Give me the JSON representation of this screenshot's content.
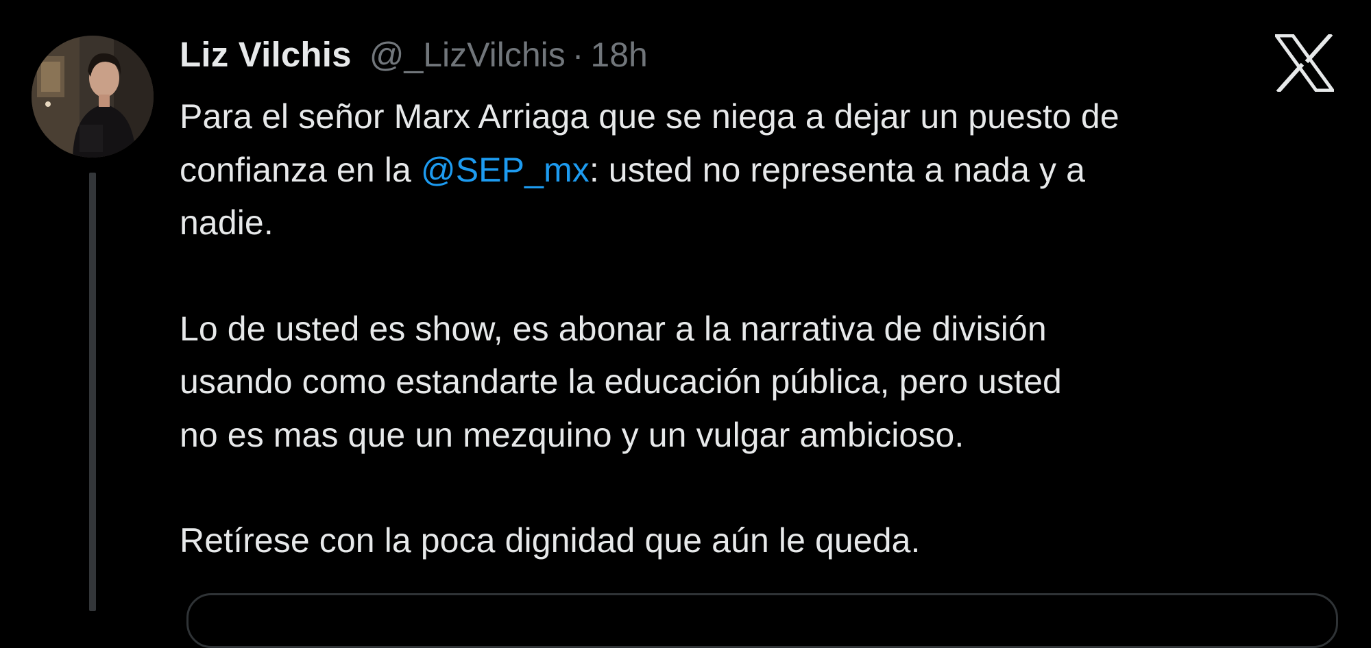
{
  "tweet": {
    "author": {
      "display_name": "Liz Vilchis",
      "handle": "@_LizVilchis",
      "separator": "·",
      "time": "18h",
      "avatar_icon": "user-avatar"
    },
    "platform_icon": "x-logo-icon",
    "body": {
      "p1_before": "Para el señor Marx Arriaga que se niega a dejar un puesto de confianza en la ",
      "p1_mention": "@SEP_mx",
      "p1_after": ": usted no representa a nada y a nadie.",
      "p1_lines": [
        "Para el señor Marx Arriaga que se niega a dejar un puesto de",
        "confianza en la ",
        ": usted no representa a nada y a",
        "nadie."
      ],
      "p2_lines": [
        "Lo de usted es show, es abonar a la narrativa de división",
        "usando como estandarte la educación pública, pero usted",
        "no es mas que un mezquino y un vulgar ambicioso."
      ],
      "p3_lines": [
        "Retírese con la poca dignidad que aún le queda."
      ]
    },
    "colors": {
      "background": "#000000",
      "text": "#e7e9ea",
      "secondary": "#71767b",
      "link": "#1d9bf0",
      "thread_line": "#333639"
    }
  }
}
